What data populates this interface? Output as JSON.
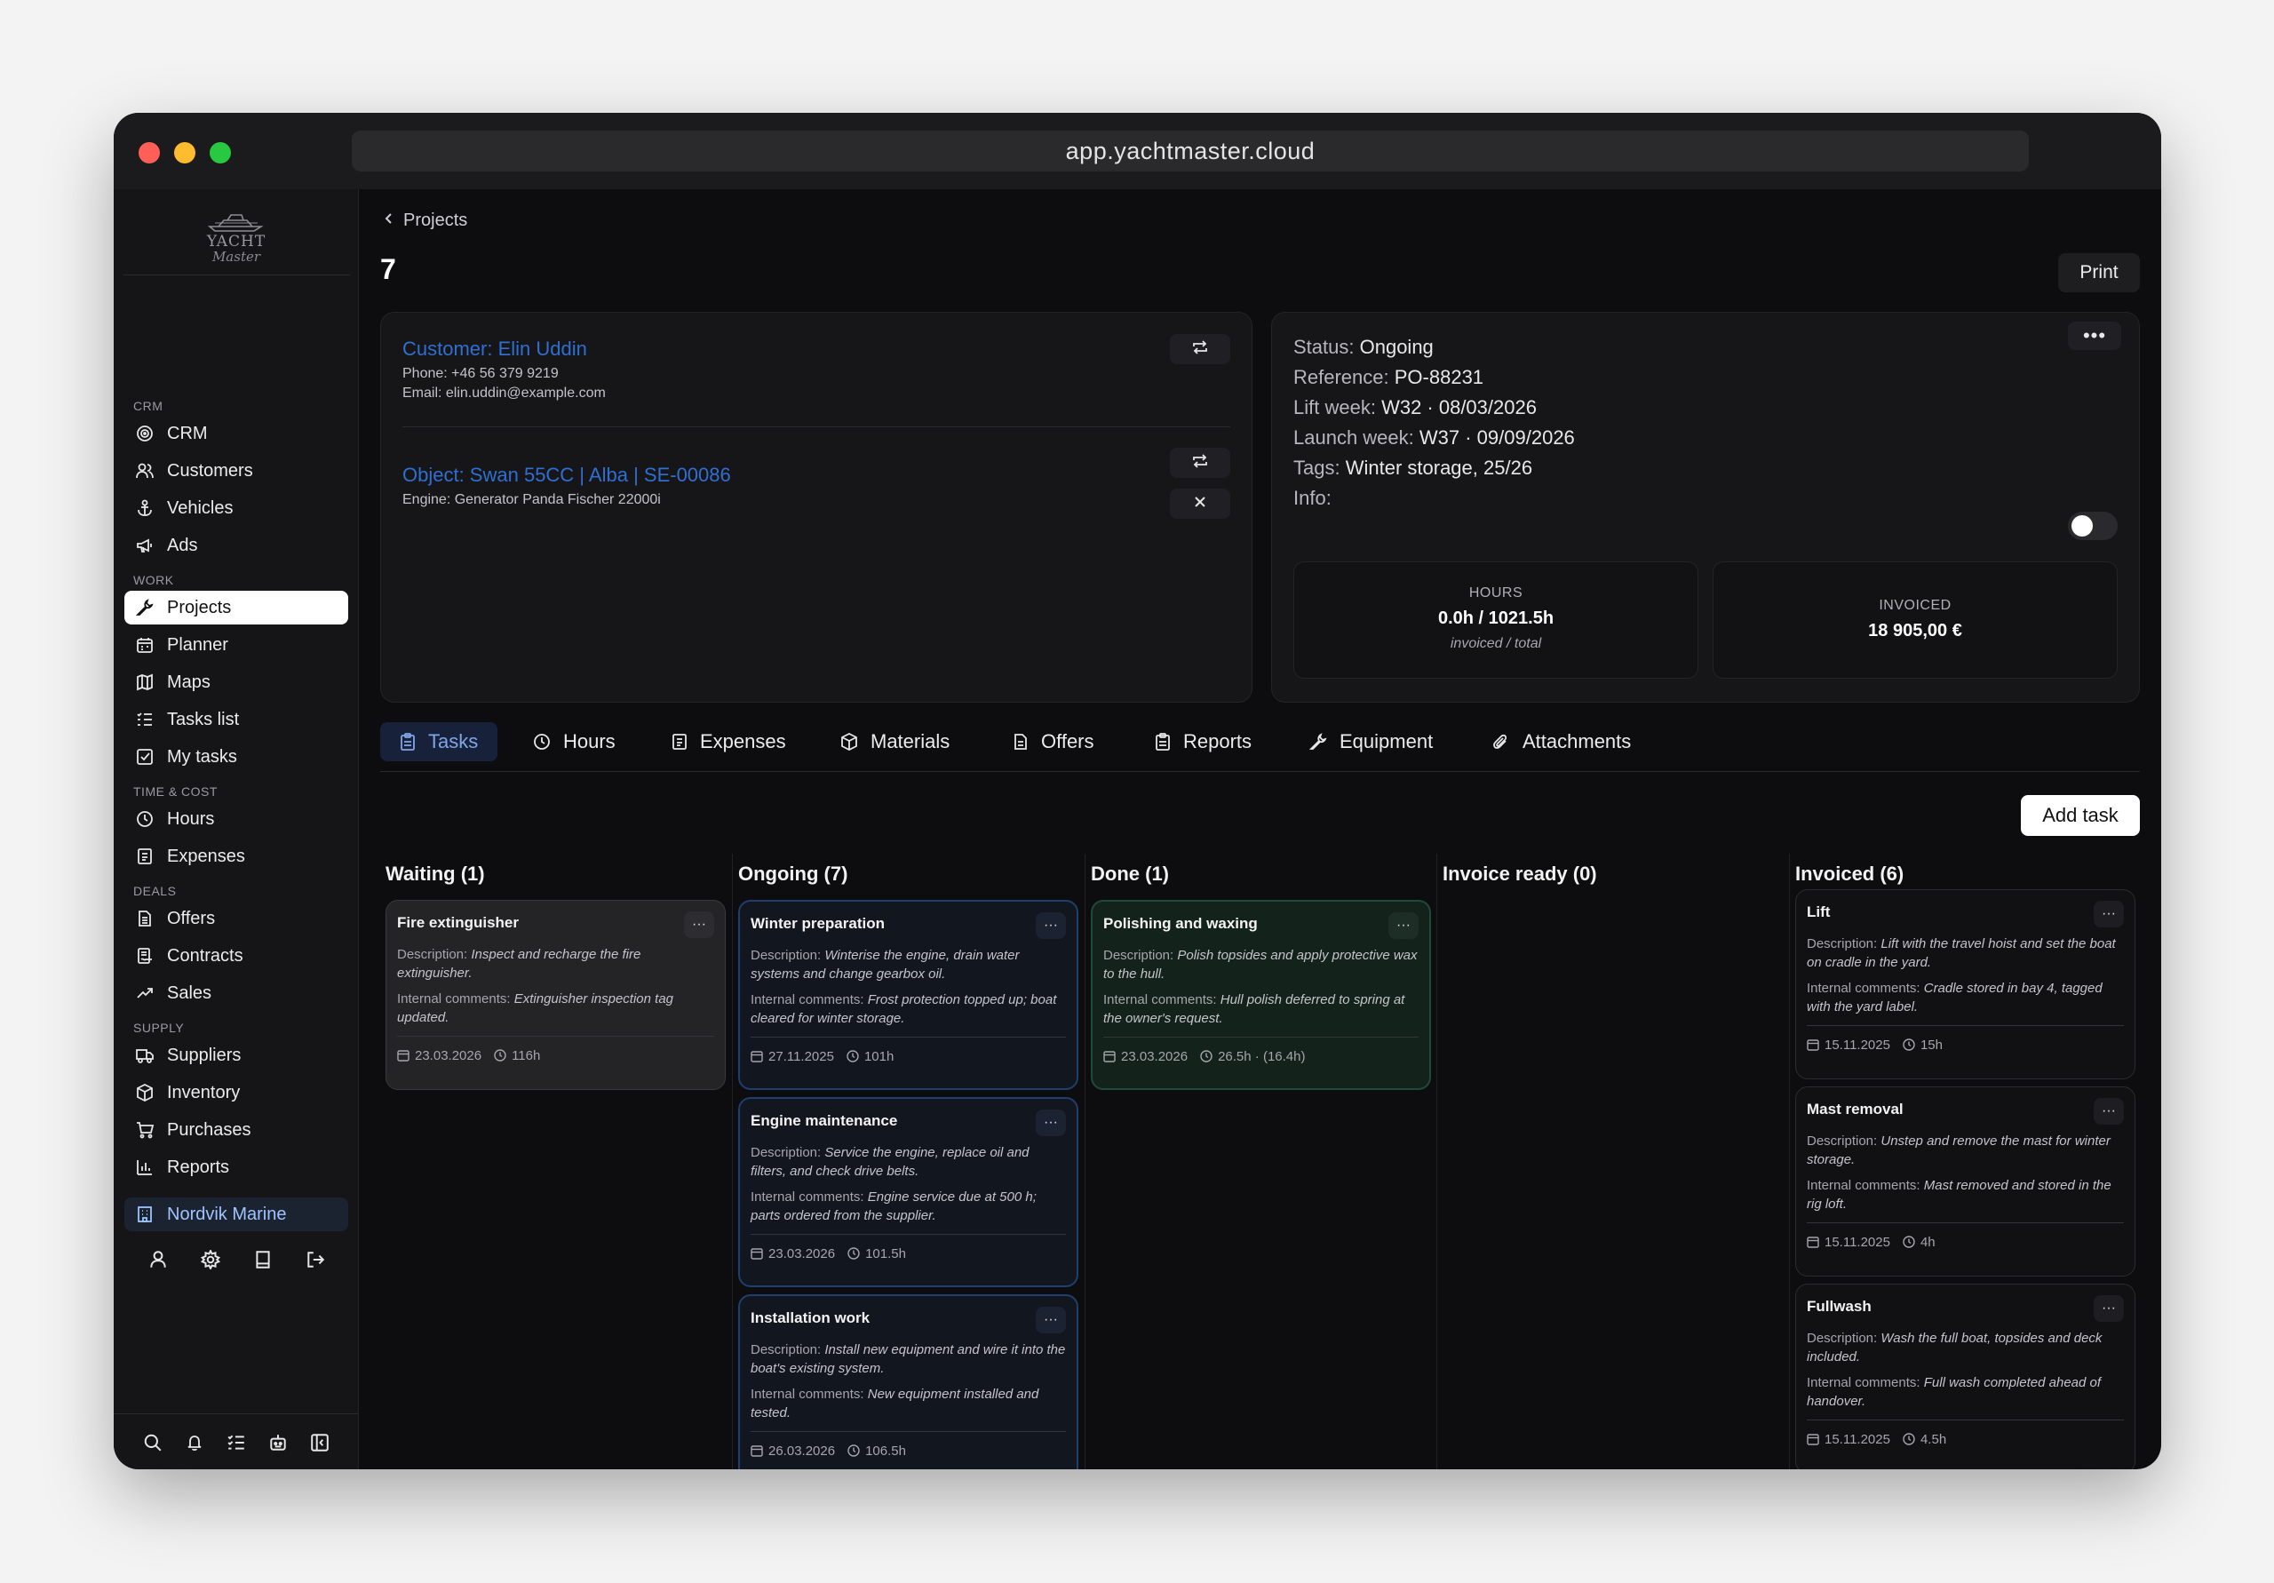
{
  "browser": {
    "url": "app.yachtmaster.cloud"
  },
  "brand": {
    "line1": "YACHT",
    "line2": "Master"
  },
  "sidebar": {
    "sections": [
      {
        "label": "CRM",
        "items": [
          {
            "label": "CRM",
            "icon": "crm-target-icon"
          },
          {
            "label": "Customers",
            "icon": "users-icon"
          },
          {
            "label": "Vehicles",
            "icon": "anchor-icon"
          },
          {
            "label": "Ads",
            "icon": "megaphone-icon"
          }
        ]
      },
      {
        "label": "WORK",
        "items": [
          {
            "label": "Projects",
            "icon": "wrench-icon",
            "active": true
          },
          {
            "label": "Planner",
            "icon": "calendar-icon"
          },
          {
            "label": "Maps",
            "icon": "map-icon"
          },
          {
            "label": "Tasks list",
            "icon": "list-icon"
          },
          {
            "label": "My tasks",
            "icon": "check-square-icon"
          }
        ]
      },
      {
        "label": "TIME & COST",
        "items": [
          {
            "label": "Hours",
            "icon": "clock-icon"
          },
          {
            "label": "Expenses",
            "icon": "receipt-icon"
          }
        ]
      },
      {
        "label": "DEALS",
        "items": [
          {
            "label": "Offers",
            "icon": "document-icon"
          },
          {
            "label": "Contracts",
            "icon": "contract-icon"
          },
          {
            "label": "Sales",
            "icon": "trend-icon"
          }
        ]
      },
      {
        "label": "SUPPLY",
        "items": [
          {
            "label": "Suppliers",
            "icon": "truck-icon"
          },
          {
            "label": "Inventory",
            "icon": "box-icon"
          },
          {
            "label": "Purchases",
            "icon": "cart-icon"
          },
          {
            "label": "Reports",
            "icon": "bar-chart-icon"
          }
        ]
      }
    ],
    "organization": "Nordvik Marine"
  },
  "project": {
    "breadcrumb": "Projects",
    "title": "7",
    "print_label": "Print",
    "customer": {
      "title": "Customer: Elin Uddin",
      "phone": "Phone: +46 56 379 9219",
      "email": "Email: elin.uddin@example.com"
    },
    "object": {
      "title": "Object: Swan 55CC | Alba | SE-00086",
      "engine": "Engine: Generator Panda Fischer 22000i"
    },
    "info": {
      "status_label": "Status:",
      "status": "Ongoing",
      "reference_label": "Reference:",
      "reference": "PO-88231",
      "lift_label": "Lift week:",
      "lift": "W32 · 08/03/2026",
      "launch_label": "Launch week:",
      "launch": "W37 · 09/09/2026",
      "tags_label": "Tags:",
      "tags": "Winter storage, 25/26",
      "info_label": "Info:"
    },
    "stats": {
      "hours_label": "HOURS",
      "hours_value": "0.0h / 1021.5h",
      "hours_sub": "invoiced / total",
      "invoiced_label": "INVOICED",
      "invoiced_value": "18 905,00 €"
    }
  },
  "tabs": [
    {
      "label": "Tasks",
      "icon": "clipboard-icon",
      "active": true
    },
    {
      "label": "Hours",
      "icon": "clock-icon"
    },
    {
      "label": "Expenses",
      "icon": "receipt-icon"
    },
    {
      "label": "Materials",
      "icon": "box-icon"
    },
    {
      "label": "Offers",
      "icon": "document-icon"
    },
    {
      "label": "Reports",
      "icon": "clipboard-icon"
    },
    {
      "label": "Equipment",
      "icon": "wrench-icon"
    },
    {
      "label": "Attachments",
      "icon": "paperclip-icon"
    }
  ],
  "add_task_label": "Add task",
  "board": {
    "desc_label": "Description:",
    "comments_label": "Internal comments:",
    "columns": [
      {
        "title": "Waiting (1)",
        "style": "grey",
        "tasks": [
          {
            "title": "Fire extinguisher",
            "description": "Inspect and recharge the fire extinguisher.",
            "comments": "Extinguisher inspection tag updated.",
            "date": "23.03.2026",
            "hours": "116h"
          }
        ]
      },
      {
        "title": "Ongoing (7)",
        "style": "blue",
        "tasks": [
          {
            "title": "Winter preparation",
            "description": "Winterise the engine, drain water systems and change gearbox oil.",
            "comments": "Frost protection topped up; boat cleared for winter storage.",
            "date": "27.11.2025",
            "hours": "101h"
          },
          {
            "title": "Engine maintenance",
            "description": "Service the engine, replace oil and filters, and check drive belts.",
            "comments": "Engine service due at 500 h; parts ordered from the supplier.",
            "date": "23.03.2026",
            "hours": "101.5h"
          },
          {
            "title": "Installation work",
            "description": "Install new equipment and wire it into the boat's existing system.",
            "comments": "New equipment installed and tested.",
            "date": "26.03.2026",
            "hours": "106.5h"
          }
        ]
      },
      {
        "title": "Done (1)",
        "style": "green",
        "tasks": [
          {
            "title": "Polishing and waxing",
            "description": "Polish topsides and apply protective wax to the hull.",
            "comments": "Hull polish deferred to spring at the owner's request.",
            "date": "23.03.2026",
            "hours": "26.5h · (16.4h)"
          }
        ]
      },
      {
        "title": "Invoice ready (0)",
        "style": "plain",
        "tasks": []
      },
      {
        "title": "Invoiced (6)",
        "style": "plain",
        "tasks": [
          {
            "title": "Lift",
            "description": "Lift with the travel hoist and set the boat on cradle in the yard.",
            "comments": "Cradle stored in bay 4, tagged with the yard label.",
            "date": "15.11.2025",
            "hours": "15h"
          },
          {
            "title": "Mast removal",
            "description": "Unstep and remove the mast for winter storage.",
            "comments": "Mast removed and stored in the rig loft.",
            "date": "15.11.2025",
            "hours": "4h"
          },
          {
            "title": "Fullwash",
            "description": "Wash the full boat, topsides and deck included.",
            "comments": "Full wash completed ahead of handover.",
            "date": "15.11.2025",
            "hours": "4.5h"
          }
        ]
      }
    ]
  }
}
